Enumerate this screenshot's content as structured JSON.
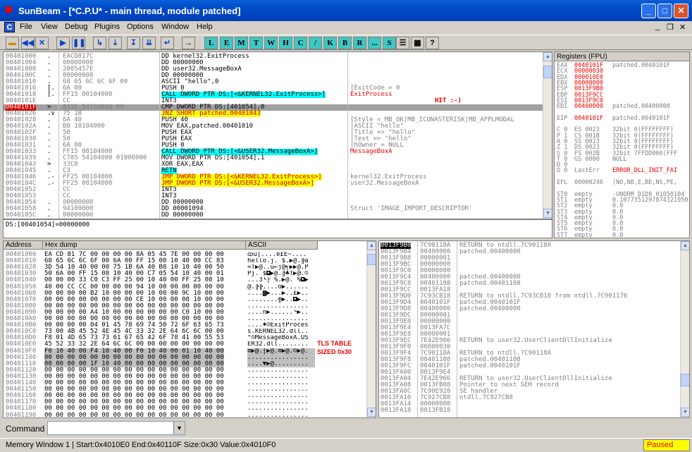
{
  "window": {
    "title": "SunBeam - [*C.P.U* - main thread, module patched]",
    "icon": "bug-icon"
  },
  "menu": [
    "File",
    "View",
    "Debug",
    "Plugins",
    "Options",
    "Window",
    "Help"
  ],
  "toolbar": {
    "letters": [
      "L",
      "E",
      "M",
      "T",
      "W",
      "H",
      "C",
      "/",
      "K",
      "B",
      "R",
      "...",
      "S"
    ]
  },
  "disasm": {
    "rows": [
      {
        "addr": "00401000",
        "m": ".",
        "hex": "EACD817C",
        "asm": "DD kernel32.ExitProcess",
        "cmt": ""
      },
      {
        "addr": "00401004",
        "m": ".",
        "hex": "00000000",
        "asm": "DD 00000000",
        "cmt": ""
      },
      {
        "addr": "00401008",
        "m": ".",
        "hex": "2005457E",
        "asm": "DD user32.MessageBoxA",
        "cmt": ""
      },
      {
        "addr": "0040100C",
        "m": ".",
        "hex": "00000000",
        "asm": "DD 00000000",
        "cmt": ""
      },
      {
        "addr": "00401010",
        "m": ".",
        "hex": "68 65 6C 6C 6F 00",
        "asm": "ASCII \"hello\",0",
        "cmt": ""
      },
      {
        "addr": "00401016",
        "m": "[.",
        "hex": "6A 00",
        "asm": "PUSH 0",
        "cmt": "[ExitCode = 0"
      },
      {
        "addr": "00401018",
        "m": "[.",
        "hex": "FF15 00104000",
        "asm": "CALL DWORD PTR DS:[<&KERNEL32.ExitProcess>]",
        "cmt": "ExitProcess",
        "hl": "cyan",
        "cr": "red"
      },
      {
        "addr": "0040101E",
        "m": "",
        "hex": "CC",
        "asm": "INT3",
        "cmt": ""
      },
      {
        "addr": "0040101F",
        "m": ">",
        "hex": "833D 54104000 00",
        "asm": "CMP DWORD PTR DS:[401054],0",
        "cmt": "",
        "sel": true
      },
      {
        "addr": "00401026",
        "m": ".v",
        "hex": "75 1B",
        "asm": "JNZ SHORT patched.00401043",
        "cmt": "",
        "hl": "yellow"
      },
      {
        "addr": "00401028",
        "m": ".",
        "hex": "6A 40",
        "asm": "PUSH 40",
        "cmt": "[Style = MB_OK|MB_ICONASTERISK|MB_APPLMODAL"
      },
      {
        "addr": "0040102A",
        "m": ".",
        "hex": "B8 10104000",
        "asm": "MOV EAX,patched.00401010",
        "cmt": "|ASCII \"hello\""
      },
      {
        "addr": "0040102F",
        "m": ".",
        "hex": "50",
        "asm": "PUSH EAX",
        "cmt": "|Title => \"hello\""
      },
      {
        "addr": "00401030",
        "m": ".",
        "hex": "50",
        "asm": "PUSH EAX",
        "cmt": "|Text => \"hello\""
      },
      {
        "addr": "00401031",
        "m": ".",
        "hex": "6A 00",
        "asm": "PUSH 0",
        "cmt": "|hOwner = NULL"
      },
      {
        "addr": "00401033",
        "m": ".",
        "hex": "FF15 08104000",
        "asm": "CALL DWORD PTR DS:[<&USER32.MessageBoxA>]",
        "cmt": "MessageBoxA",
        "hl": "cyan",
        "cr": "red"
      },
      {
        "addr": "00401039",
        "m": ".",
        "hex": "C705 54104000 01000000",
        "asm": "MOV DWORD PTR DS:[401054],1",
        "cmt": ""
      },
      {
        "addr": "00401043",
        "m": ">",
        "hex": "33C0",
        "asm": "XOR EAX,EAX",
        "cmt": ""
      },
      {
        "addr": "00401045",
        "m": ".",
        "hex": "C3",
        "asm": "RETN",
        "cmt": "",
        "hl": "cyan"
      },
      {
        "addr": "00401046",
        "m": ".-",
        "hex": "FF25 00104000",
        "asm": "JMP DWORD PTR DS:[<&KERNEL32.ExitProcess>]",
        "cmt": "kernel32.ExitProcess",
        "hl": "yellow"
      },
      {
        "addr": "0040104C",
        "m": ".-",
        "hex": "FF25 08104000",
        "asm": "JMP DWORD PTR DS:[<&USER32.MessageBoxA>]",
        "cmt": "user32.MessageBoxA",
        "hl": "yellow"
      },
      {
        "addr": "00401052",
        "m": "",
        "hex": "CC",
        "asm": "INT3",
        "cmt": ""
      },
      {
        "addr": "00401053",
        "m": "",
        "hex": "CC",
        "asm": "INT3",
        "cmt": ""
      },
      {
        "addr": "00401054",
        "m": ".",
        "hex": "00000000",
        "asm": "DD 00000000",
        "cmt": ""
      },
      {
        "addr": "00401058",
        "m": ".",
        "hex": "94100000",
        "asm": "DD 00001094",
        "cmt": "Struct 'IMAGE_IMPORT_DESCRIPTOR'"
      },
      {
        "addr": "0040105C",
        "m": ".",
        "hex": "00000000",
        "asm": "DD 00000000",
        "cmt": ""
      }
    ],
    "annotation": "HIT :-)",
    "info": "DS:[00401054]=00000000"
  },
  "registers": {
    "title": "Registers (FPU)",
    "rows": [
      {
        "n": "EAX",
        "v": "0040101F",
        "c": "patched.0040101F",
        "red": true
      },
      {
        "n": "ECX",
        "v": "00000030",
        "c": "",
        "red": true
      },
      {
        "n": "EDX",
        "v": "000010E0",
        "c": "",
        "red": true
      },
      {
        "n": "EBX",
        "v": "00000000",
        "c": "",
        "red": true
      },
      {
        "n": "ESP",
        "v": "0013F9B0",
        "c": "",
        "red": true
      },
      {
        "n": "EBP",
        "v": "0013F9CC",
        "c": "",
        "red": true
      },
      {
        "n": "ESI",
        "v": "0013F9C0",
        "c": "",
        "red": true
      },
      {
        "n": "EDI",
        "v": "00400000",
        "c": "patched.00400000",
        "red": true
      },
      {
        "n": "",
        "v": "",
        "c": ""
      },
      {
        "n": "EIP",
        "v": "0040101F",
        "c": "patched.0040101F",
        "red": true
      },
      {
        "n": "",
        "v": "",
        "c": ""
      },
      {
        "n": "C 0",
        "v": "ES 0023",
        "c": "32bit 0(FFFFFFFF)"
      },
      {
        "n": "P 1",
        "v": "CS 001B",
        "c": "32bit 0(FFFFFFFF)"
      },
      {
        "n": "A 0",
        "v": "SS 0023",
        "c": "32bit 0(FFFFFFFF)"
      },
      {
        "n": "Z 1",
        "v": "DS 0023",
        "c": "32bit 0(FFFFFFFF)"
      },
      {
        "n": "S 0",
        "v": "FS 003B",
        "c": "32bit 7FFDD000(FFF"
      },
      {
        "n": "T 0",
        "v": "GS 0000",
        "c": "NULL"
      },
      {
        "n": "D 0",
        "v": "",
        "c": ""
      },
      {
        "n": "O 0",
        "v": "LastErr",
        "c": "ERROR_DLL_INIT_FAI"
      },
      {
        "n": "",
        "v": "",
        "c": ""
      },
      {
        "n": "EFL",
        "v": "00000246",
        "c": "(NO,NB,E,BE,NS,PE,"
      },
      {
        "n": "",
        "v": "",
        "c": ""
      },
      {
        "n": "ST0",
        "v": "empty",
        "c": "-UNORM D1D8 01050104"
      },
      {
        "n": "ST1",
        "v": "empty",
        "c": "0.1077351297874321950"
      },
      {
        "n": "ST2",
        "v": "empty",
        "c": "0.0"
      },
      {
        "n": "ST3",
        "v": "empty",
        "c": "0.0"
      },
      {
        "n": "ST4",
        "v": "empty",
        "c": "0.0"
      },
      {
        "n": "ST5",
        "v": "empty",
        "c": "0.0"
      },
      {
        "n": "ST6",
        "v": "empty",
        "c": "0.0"
      },
      {
        "n": "ST7",
        "v": "empty",
        "c": "0.0"
      }
    ]
  },
  "dump": {
    "headers": [
      "Address",
      "Hex dump",
      "ASCII"
    ],
    "rows": [
      {
        "a": "00401000",
        "h": "EA CD 81 7C 00 00 00 00 8A 05 45 7E 00 00 00 00",
        "s": "ꭃü|....è£E~...."
      },
      {
        "a": "00401010",
        "h": "68 65 6C 6C 6F 00 6A 00 FF 15 00 10 40 00 CC 83",
        "s": "hello.j. $.▶@.╠â"
      },
      {
        "a": "00401020",
        "h": "3D 54 10 40 00 00 75 1B 6A 40 B8 10 10 40 00 50",
        "s": "=T▶@..u←j@╕▶▶@.P"
      },
      {
        "a": "00401030",
        "h": "50 6A 00 FF 15 08 10 40 00 C7 05 54 10 40 00 01",
        "s": "Pj. $◘▶@.╟♣T▶@.☺"
      },
      {
        "a": "00401040",
        "h": "00 00 00 33 C0 C3 FF 25 00 10 40 00 FF 25 08 10",
        "s": "...3└├ %.▶@. %◘▶"
      },
      {
        "a": "00401050",
        "h": "40 00 CC CC 00 00 00 00 94 10 00 00 00 00 00 00",
        "s": "@.╠╠....ö▶......"
      },
      {
        "a": "00401060",
        "h": "00 00 00 00 B2 10 00 00 00 10 00 00 9C 10 00 00",
        "s": "....▓▶...▶..£▶.."
      },
      {
        "a": "00401070",
        "h": "00 00 00 00 00 00 00 00 CE 10 00 00 08 10 00 00",
        "s": "........╬▶..◘▶.."
      },
      {
        "a": "00401080",
        "h": "00 00 00 00 00 00 00 00 00 00 00 00 00 00 00 00",
        "s": "................"
      },
      {
        "a": "00401090",
        "h": "00 00 00 00 A4 10 00 00 00 00 00 00 C0 10 00 00",
        "s": "....ñ▶......└▶.."
      },
      {
        "a": "004010A0",
        "h": "00 00 00 00 00 00 00 00 00 00 00 00 00 00 00 00",
        "s": "................"
      },
      {
        "a": "004010B0",
        "h": "00 00 00 00 04 01 45 78 69 74 50 72 6F 63 65 73",
        "s": "....♦☺ExitProces"
      },
      {
        "a": "004010C0",
        "h": "73 00 4B 45 52 4E 45 4C 33 32 2E 64 6C 6C 00 00",
        "s": "s.KERNEL32.dll.."
      },
      {
        "a": "004010D0",
        "h": "F8 01 4D 65 73 73 61 67 65 42 6F 78 41 00 55 53",
        "s": "°☺MessageBoxA.US"
      },
      {
        "a": "004010E0",
        "h": "45 52 33 32 2E 64 6C 6C 00 00 00 00 00 00 00 00",
        "s": "ER32.dll........"
      },
      {
        "a": "004010F0",
        "h": "F0 10 40 00 F4 10 40 00 F0 10 40 00 01 10 40 00",
        "s": "≡▶@.⌠▶@.≡▶@.☺▶@.",
        "g": true
      },
      {
        "a": "00401100",
        "h": "00 00 00 00 00 00 00 00 00 00 00 00 00 00 00 00",
        "s": "................",
        "g": true
      },
      {
        "a": "00401110",
        "h": "00 00 00 00 1F 10 40 00 00 00 00 00 00 00 00 00",
        "s": "....▼▶@.........",
        "g": true
      },
      {
        "a": "00401120",
        "h": "00 00 00 00 00 00 00 00 00 00 00 00 00 00 00 00",
        "s": "................"
      },
      {
        "a": "00401130",
        "h": "00 00 00 00 00 00 00 00 00 00 00 00 00 00 00 00",
        "s": "................"
      },
      {
        "a": "00401140",
        "h": "00 00 00 00 00 00 00 00 00 00 00 00 00 00 00 00",
        "s": "................"
      },
      {
        "a": "00401150",
        "h": "00 00 00 00 00 00 00 00 00 00 00 00 00 00 00 00",
        "s": "................"
      },
      {
        "a": "00401160",
        "h": "00 00 00 00 00 00 00 00 00 00 00 00 00 00 00 00",
        "s": "................"
      },
      {
        "a": "00401170",
        "h": "00 00 00 00 00 00 00 00 00 00 00 00 00 00 00 00",
        "s": "................"
      },
      {
        "a": "00401180",
        "h": "00 00 00 00 00 00 00 00 00 00 00 00 00 00 00 00",
        "s": "................"
      },
      {
        "a": "00401190",
        "h": "00 00 00 00 00 00 00 00 00 00 00 00 00 00 00 00",
        "s": "................"
      }
    ],
    "annotation_line1": "TLS TABLE",
    "annotation_line2": "SIZED 0x30"
  },
  "stack": {
    "rows": [
      {
        "a": "0013F9B0",
        "v": "7C90118A",
        "c": "RETURN to ntdll.7C90118A",
        "sel": true
      },
      {
        "a": "0013F9B4",
        "v": "00400000",
        "c": "patched.00400000"
      },
      {
        "a": "0013F9B8",
        "v": "00000001",
        "c": ""
      },
      {
        "a": "0013F9BC",
        "v": "00000000",
        "c": ""
      },
      {
        "a": "0013F9C0",
        "v": "00000000",
        "c": ""
      },
      {
        "a": "0013F9C4",
        "v": "00400000",
        "c": "patched.00400000"
      },
      {
        "a": "0013F9C8",
        "v": "00401108",
        "c": "patched.00401108"
      },
      {
        "a": "0013F9CC",
        "v": "0013FA18",
        "c": ""
      },
      {
        "a": "0013F9D0",
        "v": "7C93CB18",
        "c": "RETURN to ntdll.7C93CB18 from ntdll.7C901176"
      },
      {
        "a": "0013F9D4",
        "v": "0040101F",
        "c": "patched.0040101F"
      },
      {
        "a": "0013F9D8",
        "v": "00400000",
        "c": "patched.00400000"
      },
      {
        "a": "0013F9DC",
        "v": "00000001",
        "c": ""
      },
      {
        "a": "0013F9E0",
        "v": "00000000",
        "c": ""
      },
      {
        "a": "0013F9E4",
        "v": "0013FA7C",
        "c": ""
      },
      {
        "a": "0013F9E8",
        "v": "00000001",
        "c": ""
      },
      {
        "a": "0013F9EC",
        "v": "7E42E966",
        "c": "RETURN to user32.UserClientDllInitialize"
      },
      {
        "a": "0013F9F0",
        "v": "00000030",
        "c": ""
      },
      {
        "a": "0013F9F4",
        "v": "7C90118A",
        "c": "RETURN to ntdll.7C90118A"
      },
      {
        "a": "0013F9F8",
        "v": "00401108",
        "c": "patched.00401108"
      },
      {
        "a": "0013F9FC",
        "v": "0040101F",
        "c": "patched.0040101F"
      },
      {
        "a": "0013FA00",
        "v": "0013F9E4",
        "c": ""
      },
      {
        "a": "0013FA04",
        "v": "7E42E966",
        "c": "RETURN to user32.UserClientDllInitialize"
      },
      {
        "a": "0013FA08",
        "v": "0013FB08",
        "c": "Pointer to next SEH record"
      },
      {
        "a": "0013FA0C",
        "v": "7C90E920",
        "c": "SE handler"
      },
      {
        "a": "0013FA10",
        "v": "7C927CB8",
        "c": "ntdll.7C927CB8"
      },
      {
        "a": "0013FA14",
        "v": "00000000",
        "c": ""
      },
      {
        "a": "0013FA18",
        "v": "0013FB18",
        "c": ""
      }
    ]
  },
  "command": {
    "label": "Command"
  },
  "status": {
    "text": "Memory Window 1 | Start:0x4010E0 End:0x40110F Size:0x30 Value:0x4010F0",
    "state": "Paused"
  }
}
